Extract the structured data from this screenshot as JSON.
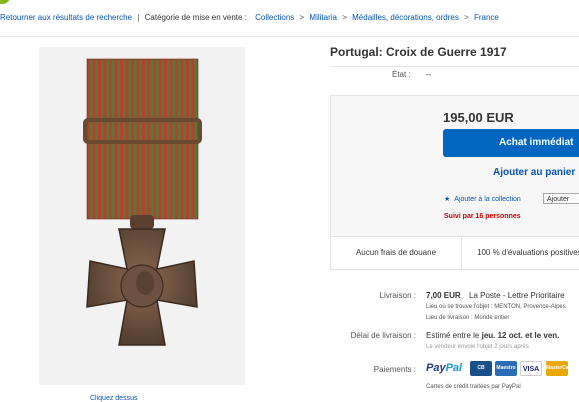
{
  "breadcrumb": {
    "back_link": "Retourner aux résultats de recherche",
    "category_label": "Catégorie de mise en vente :",
    "items": [
      "Collections",
      "Militaria",
      "Médailles, décorations, ordres",
      "France"
    ]
  },
  "listing": {
    "title": "Portugal: Croix de Guerre 1917",
    "condition_label": "État :",
    "condition_value": "--",
    "price": "195,00 EUR",
    "buy_now_label": "Achat immédiat",
    "add_to_cart_label": "Ajouter au panier",
    "watch_link": "Ajouter à la collection",
    "watch_button": "Ajouter",
    "followers": "Suivi par 16 personnes"
  },
  "info_bar": {
    "customs": "Aucun frais de douane",
    "feedback": "100 % d'évaluations positives"
  },
  "shipping": {
    "label": "Livraison :",
    "cost": "7,00 EUR",
    "method": "La Poste - Lettre Prioritaire",
    "item_location": "Lieu où se trouve l'objet : MENTON, Provence-Alpes",
    "ships_to": "Lieu de livraison : Monde entier"
  },
  "delivery": {
    "label": "Délai de livraison :",
    "estimate_prefix": "Estimé entre le",
    "estimate_dates": "jeu. 12 oct. et le ven.",
    "note": "Le vendeur envoie l'objet 2 jours après"
  },
  "payments": {
    "label": "Paiements :",
    "paypal_part1": "Pay",
    "paypal_part2": "Pal",
    "cards": [
      "CB",
      "Maestro",
      "VISA",
      "MasterCard"
    ],
    "note": "Cartes de crédit traitées par PayPal"
  },
  "thumbnail_caption": "Cliquez dessus"
}
